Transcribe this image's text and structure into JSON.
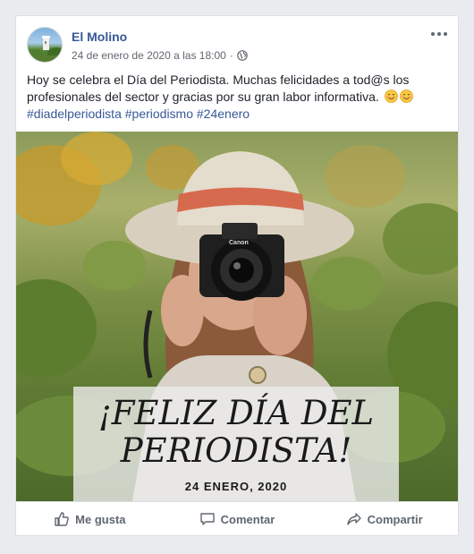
{
  "post": {
    "page_name": "El Molino",
    "timestamp": "24 de enero de 2020 a las 18:00",
    "separator": "·",
    "text": "Hoy se celebra el Día del Periodista. Muchas felicidades a tod@s los profesionales del sector y gracias por su gran labor informativa.",
    "hashtags": "#diadelperiodista #periodismo #24enero"
  },
  "image": {
    "headline_line1": "¡FELIZ DÍA DEL",
    "headline_line2": "PERIODISTA!",
    "date": "24 ENERO, 2020",
    "camera_brand": "Canon"
  },
  "actions": {
    "like": "Me gusta",
    "comment": "Comentar",
    "share": "Compartir"
  },
  "colors": {
    "link": "#385898",
    "text": "#1d2129",
    "muted": "#606770"
  }
}
